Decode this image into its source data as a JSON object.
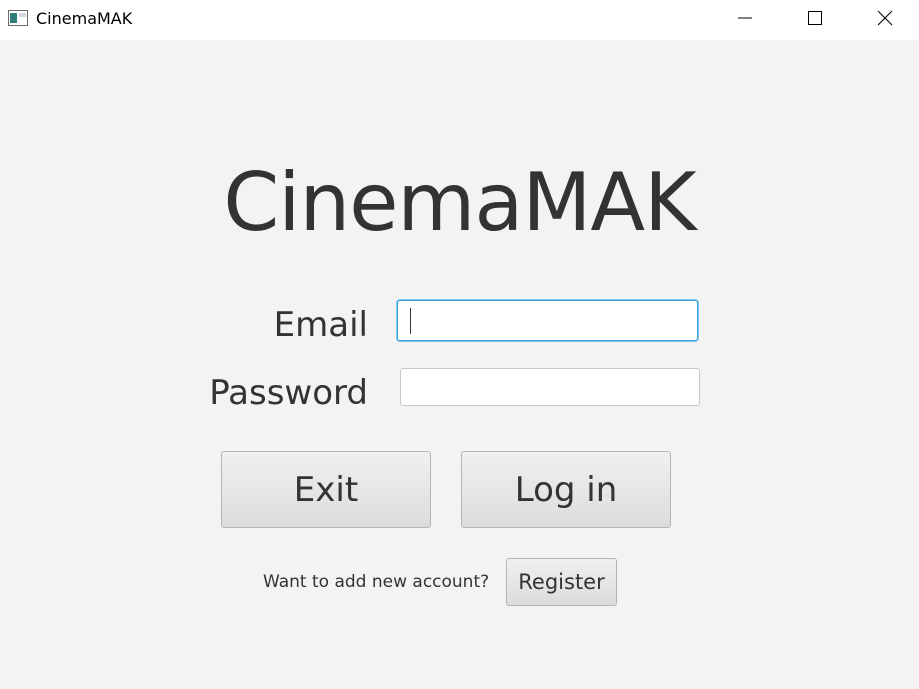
{
  "window": {
    "title": "CinemaMAK",
    "icon": "app-window-icon",
    "controls": {
      "minimize_icon": "minimize-icon",
      "maximize_icon": "maximize-icon",
      "close_icon": "close-icon"
    }
  },
  "login": {
    "heading": "CinemaMAK",
    "email_label": "Email",
    "email_value": "",
    "password_label": "Password",
    "password_value": "",
    "exit_button": "Exit",
    "login_button": "Log in",
    "register_prompt": "Want to add new account?",
    "register_button": "Register"
  },
  "colors": {
    "background": "#f3f3f3",
    "titlebar": "#ffffff",
    "focus_border": "#3aa2d6",
    "text": "#333333"
  }
}
